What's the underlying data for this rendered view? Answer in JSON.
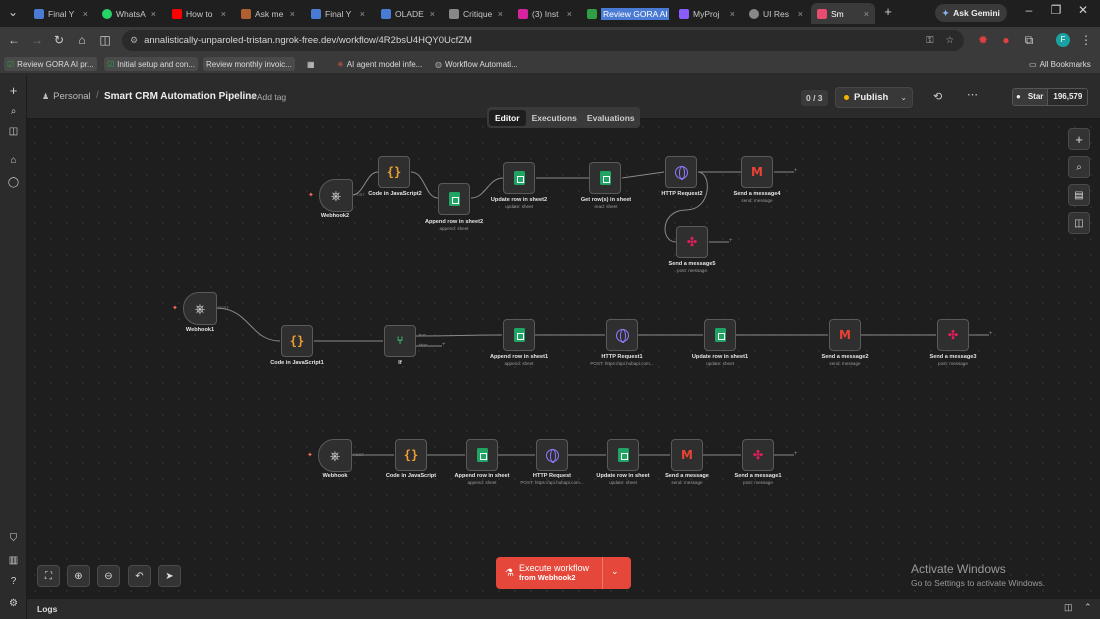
{
  "browser": {
    "tabs": [
      {
        "label": "Final Y",
        "color": "#4a7bd4"
      },
      {
        "label": "WhatsA",
        "color": "#25d366"
      },
      {
        "label": "How to",
        "color": "#ff0000"
      },
      {
        "label": "Ask me",
        "color": "#b06030"
      },
      {
        "label": "Final Y",
        "color": "#4a7bd4"
      },
      {
        "label": "OLADE",
        "color": "#4a7bd4"
      },
      {
        "label": "Critique",
        "color": "#888888"
      },
      {
        "label": "(3) Inst",
        "color": "#d6249f"
      },
      {
        "label": "Review GORA AI p",
        "color": "#2f9e44"
      },
      {
        "label": "MyProj",
        "color": "#8a5cff"
      },
      {
        "label": "UI Res",
        "color": "#888888"
      },
      {
        "label": "Sm",
        "color": "#ea4b71"
      }
    ],
    "new_tab": "+",
    "ask_gemini": "Ask Gemini",
    "url": "annalistically-unparoled-tristan.ngrok-free.dev/workflow/4R2bsU4HQY0UcfZM",
    "bookmarks": [
      "Review GORA AI pr...",
      "Initial setup and con...",
      "Review monthly invoic...",
      "AI agent model infe...",
      "Workflow Automati..."
    ],
    "all_bookmarks": "All Bookmarks"
  },
  "header": {
    "project": "Personal",
    "workflow_name": "Smart CRM Automation Pipeline",
    "add_tag": "+ Add tag",
    "counter": "0 / 3",
    "publish": "Publish",
    "star_label": "Star",
    "star_count": "196,579"
  },
  "tabs": [
    "Editor",
    "Executions",
    "Evaluations"
  ],
  "nodes": {
    "w2": {
      "label": "Webhook2"
    },
    "c2": {
      "label": "Code in JavaScript2"
    },
    "a2": {
      "label": "Append row in sheet2",
      "sub": "append: sheet"
    },
    "u2": {
      "label": "Update row in sheet2",
      "sub": "update: sheet"
    },
    "g": {
      "label": "Get row(s) in sheet",
      "sub": "read: sheet"
    },
    "h2": {
      "label": "HTTP Request2"
    },
    "m4": {
      "label": "Send a message4",
      "sub": "send: message"
    },
    "s5": {
      "label": "Send a message5",
      "sub": "post: message"
    },
    "w1": {
      "label": "Webhook1"
    },
    "c1": {
      "label": "Code in JavaScript1"
    },
    "if": {
      "label": "If"
    },
    "a1": {
      "label": "Append row in sheet1",
      "sub": "append: sheet"
    },
    "h1": {
      "label": "HTTP Request1",
      "sub": "POST: https://api.hubapi.com..."
    },
    "u1": {
      "label": "Update row in sheet1",
      "sub": "update: sheet"
    },
    "m2": {
      "label": "Send a message2",
      "sub": "send: message"
    },
    "s3": {
      "label": "Send a message3",
      "sub": "post: message"
    },
    "w0": {
      "label": "Webhook"
    },
    "c0": {
      "label": "Code in JavaScript"
    },
    "a0": {
      "label": "Append row in sheet",
      "sub": "append: sheet"
    },
    "h0": {
      "label": "HTTP Request",
      "sub": "POST: https://api.hubapi.com..."
    },
    "u0": {
      "label": "Update row in sheet",
      "sub": "update: sheet"
    },
    "m0": {
      "label": "Send a message",
      "sub": "send: message"
    },
    "s1": {
      "label": "Send a message1",
      "sub": "post: message"
    }
  },
  "edge_labels": {
    "post": "POST",
    "true": "true",
    "false": "false"
  },
  "execute": {
    "title": "Execute workflow",
    "subtitle": "from Webhook2"
  },
  "logs": "Logs",
  "watermark": {
    "title": "Activate Windows",
    "subtitle": "Go to Settings to activate Windows."
  },
  "colors": {
    "accent": "#ff6d5a",
    "execute_bg": "#e5483b",
    "publish_dot": "#f5b400"
  }
}
